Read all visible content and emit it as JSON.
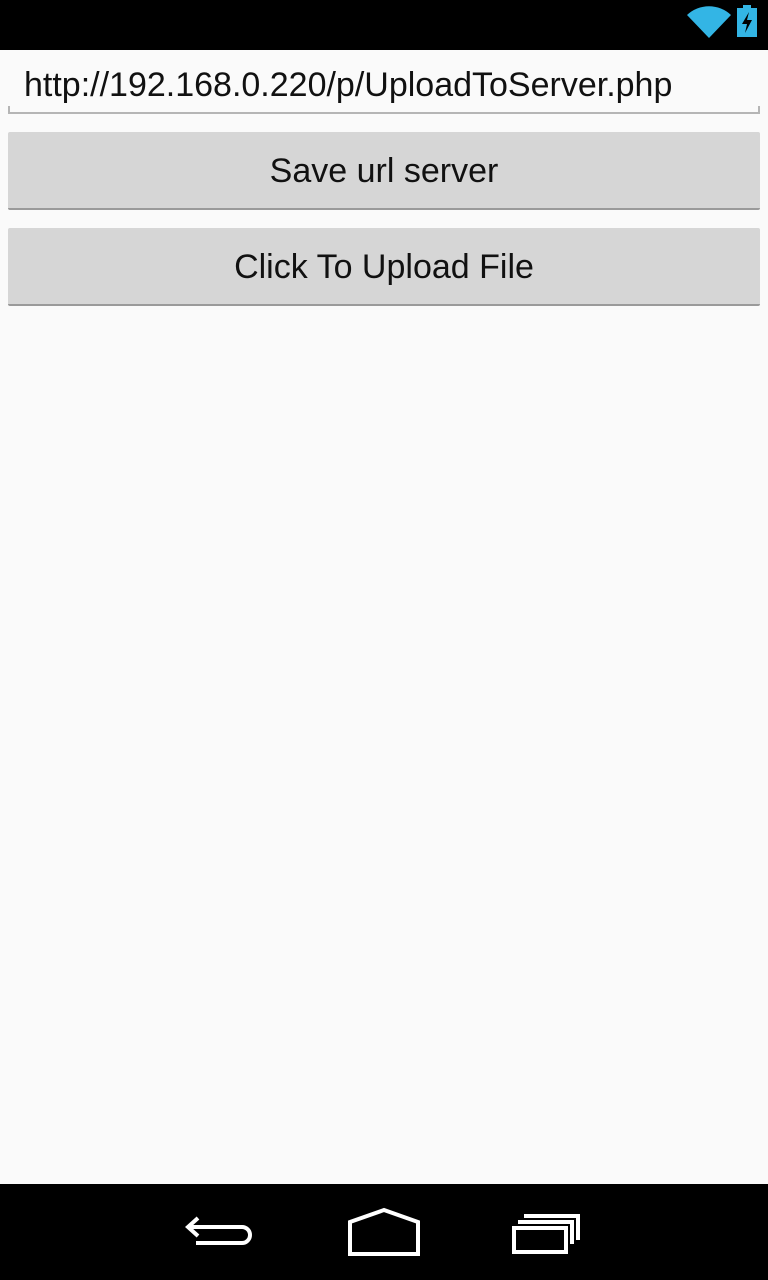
{
  "status_bar": {
    "icons": [
      "wifi-icon",
      "battery-charging-icon"
    ],
    "accent_color": "#33b5e5"
  },
  "form": {
    "url_value": "http://192.168.0.220/p/UploadToServer.php",
    "save_label": "Save url server",
    "upload_label": "Click To Upload File"
  },
  "nav_bar": {
    "icons": [
      "back-icon",
      "home-icon",
      "recent-apps-icon"
    ]
  }
}
